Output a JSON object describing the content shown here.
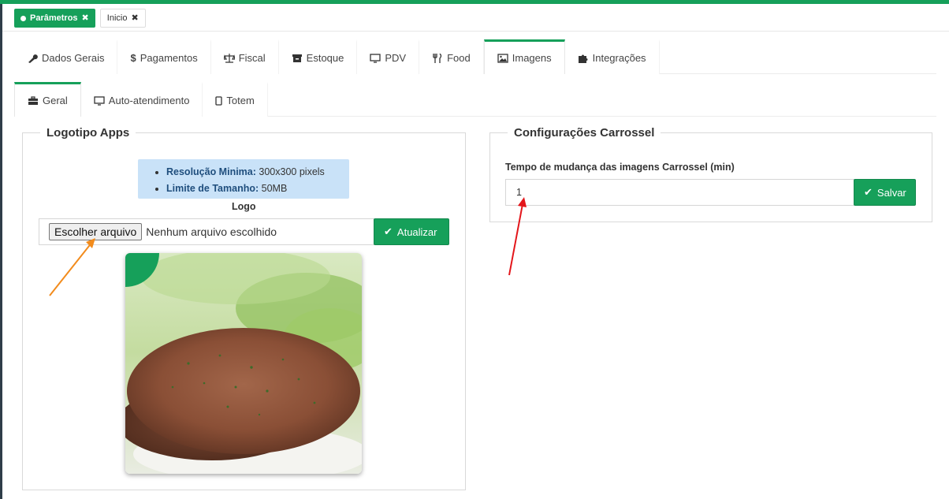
{
  "header": {
    "page_tabs": [
      {
        "label": "Parâmetros",
        "active": true
      },
      {
        "label": "Inicio",
        "active": false
      }
    ]
  },
  "main_tabs": [
    {
      "label": "Dados Gerais",
      "icon": "wrench-icon"
    },
    {
      "label": "Pagamentos",
      "icon": "dollar-icon"
    },
    {
      "label": "Fiscal",
      "icon": "balance-scale-icon"
    },
    {
      "label": "Estoque",
      "icon": "archive-icon"
    },
    {
      "label": "PDV",
      "icon": "monitor-icon"
    },
    {
      "label": "Food",
      "icon": "cutlery-icon"
    },
    {
      "label": "Imagens",
      "icon": "image-icon",
      "active": true
    },
    {
      "label": "Integrações",
      "icon": "puzzle-icon"
    }
  ],
  "sub_tabs": [
    {
      "label": "Geral",
      "icon": "briefcase-icon",
      "active": true
    },
    {
      "label": "Auto-atendimento",
      "icon": "desktop-icon"
    },
    {
      "label": "Totem",
      "icon": "tablet-icon"
    }
  ],
  "logo_panel": {
    "title": "Logotipo Apps",
    "info": [
      {
        "label": "Resolução Minima:",
        "value": "300x300 pixels"
      },
      {
        "label": "Limite de Tamanho:",
        "value": "50MB"
      }
    ],
    "field_label": "Logo",
    "file_button": "Escolher arquivo",
    "file_status": "Nenhum arquivo escolhido",
    "update_button": "Atualizar"
  },
  "carousel_panel": {
    "title": "Configurações Carrossel",
    "field_label": "Tempo de mudança das imagens Carrossel (min)",
    "value": "1",
    "save_button": "Salvar"
  },
  "colors": {
    "accent": "#16a05a",
    "info_bg": "#c9e2f8",
    "arrow_orange": "#f28b1c",
    "arrow_red": "#e3151a"
  }
}
